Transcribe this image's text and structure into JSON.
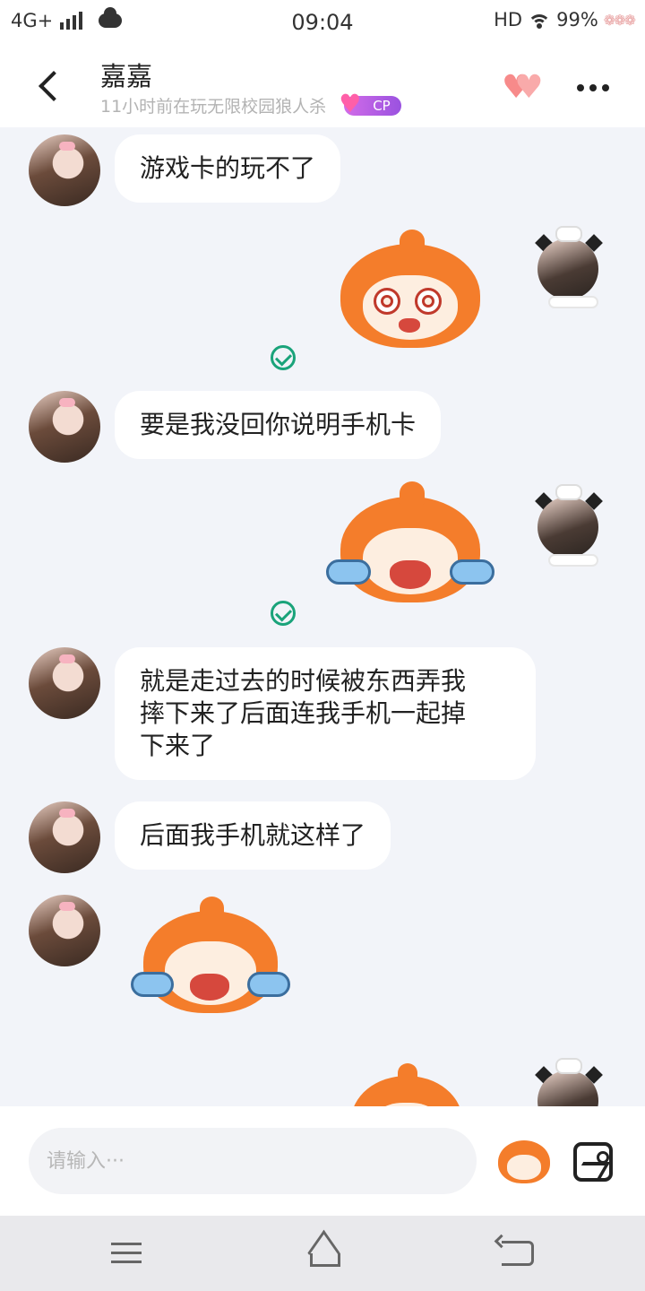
{
  "status_bar": {
    "network": "4G+",
    "time": "09:04",
    "hd": "HD",
    "battery": "99%"
  },
  "header": {
    "title": "嘉嘉",
    "subtitle": "11小时前在玩无限校园狼人杀",
    "cp_badge": "CP"
  },
  "messages": [
    {
      "side": "left",
      "type": "text",
      "text": "游戏卡的玩不了"
    },
    {
      "side": "right",
      "type": "sticker",
      "sticker": "dizzy-face",
      "read": true
    },
    {
      "side": "left",
      "type": "text",
      "text": "要是我没回你说明手机卡"
    },
    {
      "side": "right",
      "type": "sticker",
      "sticker": "crying-face",
      "read": true
    },
    {
      "side": "left",
      "type": "text",
      "line1": "就是走过去的时候被东西弄我",
      "line2": "摔下来了后面连我手机一起掉",
      "line3": "下来了"
    },
    {
      "side": "left",
      "type": "text",
      "text": "后面我手机就这样了"
    },
    {
      "side": "left",
      "type": "sticker",
      "sticker": "crying-face"
    },
    {
      "side": "right",
      "type": "sticker",
      "sticker": "orange-face-partial"
    }
  ],
  "input": {
    "placeholder": "请输入···"
  },
  "icons": {
    "back": "chevron-left-icon",
    "hearts": "double-heart-icon",
    "more": "more-dots-icon",
    "emoji": "sticker-emoji-icon",
    "image": "image-icon",
    "read": "check-circle-icon"
  },
  "colors": {
    "accent_read": "#1aa37a",
    "sticker_orange": "#f47d2b",
    "cp_purple": "#b35ee6",
    "heart_pink": "#f78a8a"
  }
}
